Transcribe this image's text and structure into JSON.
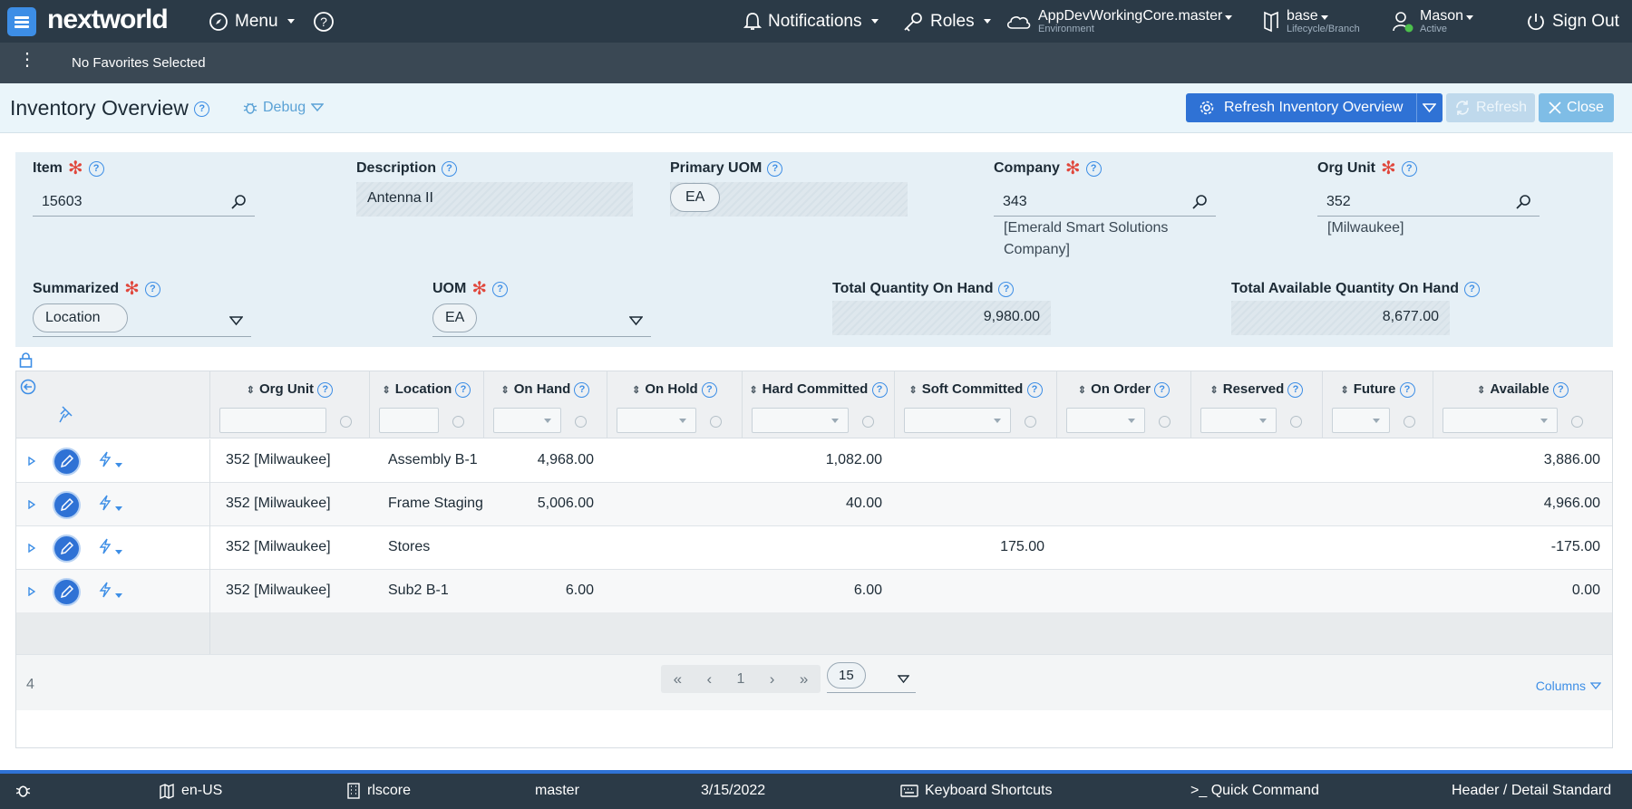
{
  "app": {
    "brand": "nextworld",
    "menu": "Menu",
    "notifications": "Notifications",
    "roles": "Roles",
    "environment": "AppDevWorkingCore.master",
    "environment_sub": "Environment",
    "branch": "base",
    "branch_sub": "Lifecycle/Branch",
    "user": "Mason",
    "user_status": "Active",
    "sign_out": "Sign Out"
  },
  "favorites": {
    "text": "No Favorites Selected"
  },
  "page": {
    "title": "Inventory Overview",
    "debug": "Debug",
    "refresh_overview": "Refresh Inventory Overview",
    "refresh": "Refresh",
    "close": "Close"
  },
  "form": {
    "item": {
      "label": "Item",
      "value": "15603"
    },
    "description": {
      "label": "Description",
      "value": "Antenna II"
    },
    "primary_uom": {
      "label": "Primary UOM",
      "value": "EA"
    },
    "company": {
      "label": "Company",
      "value": "343",
      "note": "[Emerald Smart Solutions Company]"
    },
    "org_unit": {
      "label": "Org Unit",
      "value": "352",
      "note": "[Milwaukee]"
    },
    "summarized": {
      "label": "Summarized",
      "value": "Location"
    },
    "uom": {
      "label": "UOM",
      "value": "EA"
    },
    "total_qoh": {
      "label": "Total Quantity On Hand",
      "value": "9,980.00"
    },
    "total_available": {
      "label": "Total Available Quantity On Hand",
      "value": "8,677.00"
    }
  },
  "grid": {
    "columns": [
      "Org Unit",
      "Location",
      "On Hand",
      "On Hold",
      "Hard Committed",
      "Soft Committed",
      "On Order",
      "Reserved",
      "Future",
      "Available"
    ],
    "rows": [
      {
        "org_unit": "352 [Milwaukee]",
        "location": "Assembly B-1",
        "on_hand": "4,968.00",
        "hard": "1,082.00",
        "soft": "",
        "available": "3,886.00"
      },
      {
        "org_unit": "352 [Milwaukee]",
        "location": "Frame Staging",
        "on_hand": "5,006.00",
        "hard": "40.00",
        "soft": "",
        "available": "4,966.00"
      },
      {
        "org_unit": "352 [Milwaukee]",
        "location": "Stores",
        "on_hand": "",
        "hard": "",
        "soft": "175.00",
        "available": "-175.00"
      },
      {
        "org_unit": "352 [Milwaukee]",
        "location": "Sub2 B-1",
        "on_hand": "6.00",
        "hard": "6.00",
        "soft": "",
        "available": "0.00"
      }
    ],
    "count": "4",
    "page": "1",
    "page_size": "15",
    "columns_link": "Columns"
  },
  "footer": {
    "locale": "en-US",
    "tenant": "rlscore",
    "branch": "master",
    "date": "3/15/2022",
    "shortcuts": "Keyboard Shortcuts",
    "quick_command": ">_ Quick Command",
    "layout": "Header / Detail Standard"
  },
  "colors": {
    "topbar": "#2b3a47",
    "accent": "#2f72d5",
    "required": "#e0473c"
  }
}
